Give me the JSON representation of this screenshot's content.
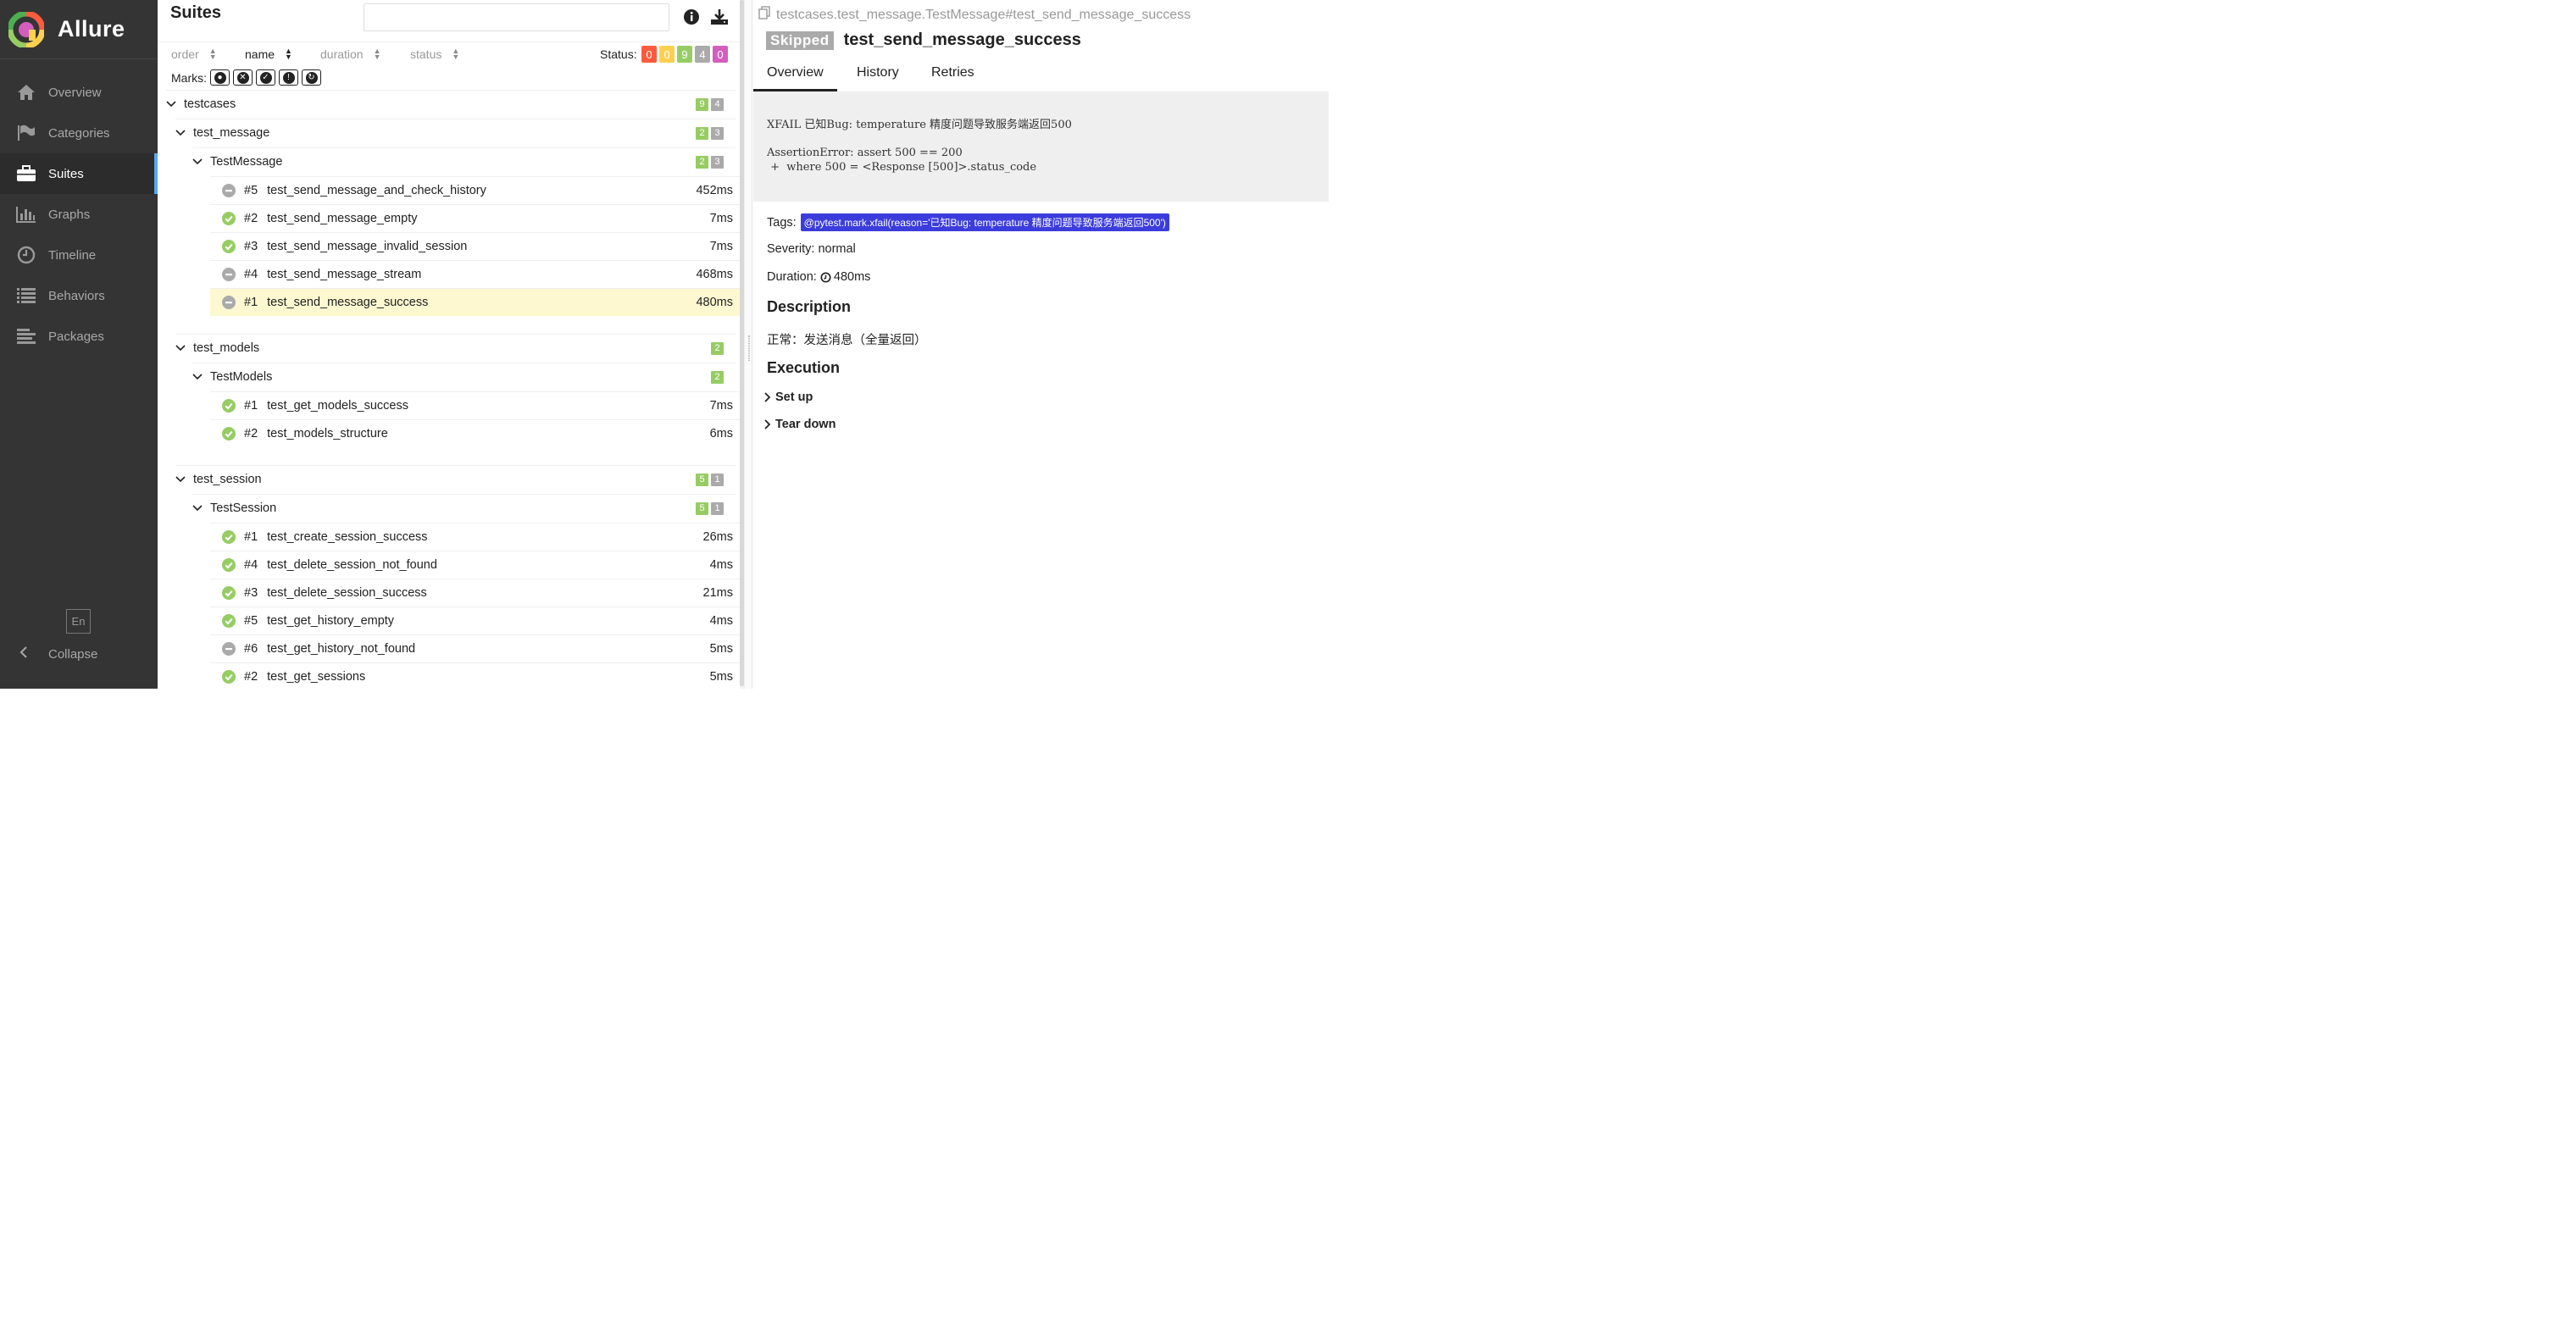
{
  "brand": {
    "name": "Allure"
  },
  "nav": [
    {
      "label": "Overview",
      "icon": "home-icon",
      "active": false
    },
    {
      "label": "Categories",
      "icon": "flag-icon",
      "active": false
    },
    {
      "label": "Suites",
      "icon": "briefcase-icon",
      "active": true
    },
    {
      "label": "Graphs",
      "icon": "bar-chart-icon",
      "active": false
    },
    {
      "label": "Timeline",
      "icon": "clock-icon",
      "active": false
    },
    {
      "label": "Behaviors",
      "icon": "list-icon",
      "active": false
    },
    {
      "label": "Packages",
      "icon": "align-left-icon",
      "active": false
    }
  ],
  "sidebar_footer": {
    "language": "En",
    "collapse": "Collapse"
  },
  "suites": {
    "title": "Suites",
    "search": {
      "value": "",
      "placeholder": ""
    },
    "sort": [
      {
        "label": "order",
        "active": false
      },
      {
        "label": "name",
        "active": true
      },
      {
        "label": "duration",
        "active": false
      },
      {
        "label": "status",
        "active": false
      }
    ],
    "status_label": "Status:",
    "status_counts": [
      {
        "value": "0",
        "color": "#fd5a3e"
      },
      {
        "value": "0",
        "color": "#ffd050"
      },
      {
        "value": "9",
        "color": "#97cc64"
      },
      {
        "value": "4",
        "color": "#aaaaaa"
      },
      {
        "value": "0",
        "color": "#d35ebe"
      }
    ],
    "marks_label": "Marks:",
    "marks": [
      "bomb-icon",
      "x-circle-icon",
      "check-circle-icon",
      "exclamation-circle-icon",
      "refresh-icon"
    ],
    "root": {
      "name": "testcases",
      "counts": [
        {
          "value": "9",
          "color": "#97cc64"
        },
        {
          "value": "4",
          "color": "#aaaaaa"
        }
      ]
    },
    "groups": [
      {
        "name": "test_message",
        "counts": [
          {
            "value": "2",
            "color": "#97cc64"
          },
          {
            "value": "3",
            "color": "#aaaaaa"
          }
        ],
        "class": "TestMessage",
        "class_counts": [
          {
            "value": "2",
            "color": "#97cc64"
          },
          {
            "value": "3",
            "color": "#aaaaaa"
          }
        ],
        "tests": [
          {
            "num": "#5",
            "name": "test_send_message_and_check_history",
            "duration": "452ms",
            "status": "skipped",
            "selected": false
          },
          {
            "num": "#2",
            "name": "test_send_message_empty",
            "duration": "7ms",
            "status": "passed",
            "selected": false
          },
          {
            "num": "#3",
            "name": "test_send_message_invalid_session",
            "duration": "7ms",
            "status": "passed",
            "selected": false
          },
          {
            "num": "#4",
            "name": "test_send_message_stream",
            "duration": "468ms",
            "status": "skipped",
            "selected": false
          },
          {
            "num": "#1",
            "name": "test_send_message_success",
            "duration": "480ms",
            "status": "skipped",
            "selected": true
          }
        ]
      },
      {
        "name": "test_models",
        "counts": [
          {
            "value": "2",
            "color": "#97cc64"
          }
        ],
        "class": "TestModels",
        "class_counts": [
          {
            "value": "2",
            "color": "#97cc64"
          }
        ],
        "tests": [
          {
            "num": "#1",
            "name": "test_get_models_success",
            "duration": "7ms",
            "status": "passed",
            "selected": false
          },
          {
            "num": "#2",
            "name": "test_models_structure",
            "duration": "6ms",
            "status": "passed",
            "selected": false
          }
        ]
      },
      {
        "name": "test_session",
        "counts": [
          {
            "value": "5",
            "color": "#97cc64"
          },
          {
            "value": "1",
            "color": "#aaaaaa"
          }
        ],
        "class": "TestSession",
        "class_counts": [
          {
            "value": "5",
            "color": "#97cc64"
          },
          {
            "value": "1",
            "color": "#aaaaaa"
          }
        ],
        "tests": [
          {
            "num": "#1",
            "name": "test_create_session_success",
            "duration": "26ms",
            "status": "passed",
            "selected": false
          },
          {
            "num": "#4",
            "name": "test_delete_session_not_found",
            "duration": "4ms",
            "status": "passed",
            "selected": false
          },
          {
            "num": "#3",
            "name": "test_delete_session_success",
            "duration": "21ms",
            "status": "passed",
            "selected": false
          },
          {
            "num": "#5",
            "name": "test_get_history_empty",
            "duration": "4ms",
            "status": "passed",
            "selected": false
          },
          {
            "num": "#6",
            "name": "test_get_history_not_found",
            "duration": "5ms",
            "status": "skipped",
            "selected": false
          },
          {
            "num": "#2",
            "name": "test_get_sessions",
            "duration": "5ms",
            "status": "passed",
            "selected": false
          }
        ]
      }
    ]
  },
  "detail": {
    "breadcrumb": "testcases.test_message.TestMessage#test_send_message_success",
    "status": "Skipped",
    "title": "test_send_message_success",
    "tabs": [
      {
        "label": "Overview",
        "active": true
      },
      {
        "label": "History",
        "active": false
      },
      {
        "label": "Retries",
        "active": false
      }
    ],
    "error_lines": [
      "XFAIL 已知Bug: temperature 精度问题导致服务端返回500",
      "",
      "AssertionError: assert 500 == 200",
      " +  where 500 = <Response [500]>.status_code"
    ],
    "tags_label": "Tags:",
    "tag": "@pytest.mark.xfail(reason='已知Bug: temperature 精度问题导致服务端返回500')",
    "severity_label": "Severity:",
    "severity": "normal",
    "duration_label": "Duration:",
    "duration": "480ms",
    "description_heading": "Description",
    "description": "正常：发送消息（全量返回）",
    "execution_heading": "Execution",
    "setup": "Set up",
    "teardown": "Tear down"
  },
  "colors": {
    "passed": "#97cc64",
    "skipped": "#aaaaaa",
    "selected_row": "#fdf8d0",
    "tag": "#3c3cdc"
  }
}
